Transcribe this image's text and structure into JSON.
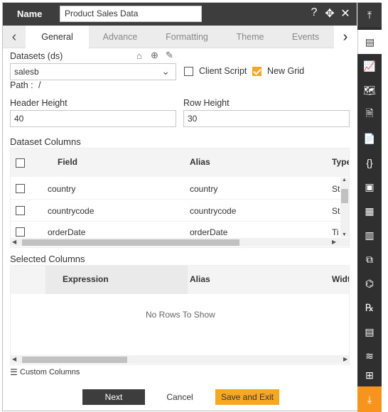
{
  "header": {
    "name_label": "Name",
    "name_value": "Product Sales Data"
  },
  "header_icons": [
    "help-icon",
    "move-icon",
    "close-icon"
  ],
  "tabs": [
    {
      "label": "General",
      "active": true
    },
    {
      "label": "Advance",
      "active": false
    },
    {
      "label": "Formatting",
      "active": false
    },
    {
      "label": "Theme",
      "active": false
    },
    {
      "label": "Events",
      "active": false
    }
  ],
  "datasets": {
    "label": "Datasets (ds)",
    "selected": "salesb",
    "client_script_label": "Client Script",
    "new_grid_label": "New Grid",
    "client_script_checked": false,
    "new_grid_checked": true,
    "path_label": "Path :",
    "path_value": "/"
  },
  "header_height": {
    "label": "Header Height",
    "value": "40"
  },
  "row_height": {
    "label": "Row Height",
    "value": "30"
  },
  "dataset_columns": {
    "title": "Dataset Columns",
    "headers": [
      "Field",
      "Alias",
      "Type"
    ],
    "rows": [
      {
        "field": "country",
        "alias": "country",
        "type": "St"
      },
      {
        "field": "countrycode",
        "alias": "countrycode",
        "type": "St"
      },
      {
        "field": "orderDate",
        "alias": "orderDate",
        "type": "Ti"
      }
    ]
  },
  "selected_columns": {
    "title": "Selected Columns",
    "headers": [
      "Expression",
      "Alias",
      "Widt"
    ],
    "empty_text": "No Rows To Show"
  },
  "custom_columns_label": "Custom Columns",
  "buttons": {
    "next": "Next",
    "cancel": "Cancel",
    "save_exit": "Save and Exit"
  },
  "colors": {
    "accent": "#f7a823",
    "dark": "#3d3d3d"
  }
}
